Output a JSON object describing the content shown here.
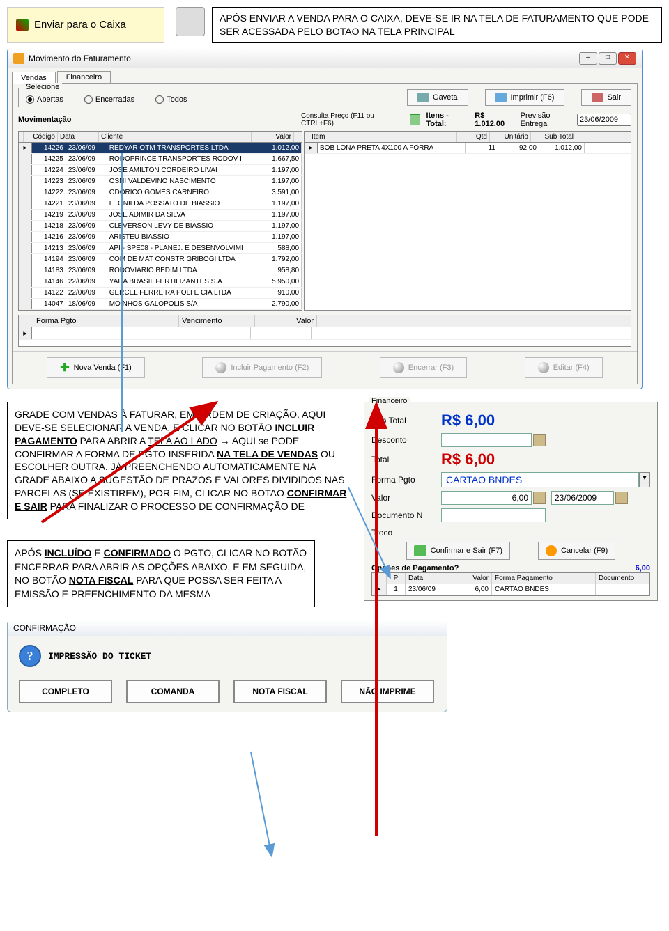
{
  "top": {
    "enviar_label": "Enviar para o Caixa",
    "callout": "APÓS ENVIAR A VENDA PARA O CAIXA, DEVE-SE IR NA TELA DE FATURAMENTO QUE PODE SER ACESSADA PELO BOTAO NA TELA PRINCIPAL"
  },
  "window": {
    "title": "Movimento do Faturamento",
    "tabs": [
      "Vendas",
      "Financeiro"
    ],
    "selecione_label": "Selecione",
    "radios": [
      "Abertas",
      "Encerradas",
      "Todos"
    ],
    "btn_gaveta": "Gaveta",
    "btn_imprimir": "Imprimir (F6)",
    "btn_sair": "Sair",
    "mov_label": "Movimentação",
    "consulta_label": "Consulta Preço (F11 ou CTRL+F6)",
    "itens_total_label": "Itens - Total:",
    "itens_total_value": "R$ 1.012,00",
    "prev_label": "Previsão Entrega",
    "prev_value": "23/06/2009",
    "grid_left_headers": [
      "Código",
      "Data",
      "Cliente",
      "Valor"
    ],
    "grid_left_rows": [
      {
        "cod": "14226",
        "data": "23/06/09",
        "cli": "REDYAR OTM TRANSPORTES LTDA",
        "val": "1.012,00",
        "sel": true
      },
      {
        "cod": "14225",
        "data": "23/06/09",
        "cli": "RODOPRINCE TRANSPORTES RODOV I",
        "val": "1.667,50"
      },
      {
        "cod": "14224",
        "data": "23/06/09",
        "cli": "JOSE AMILTON CORDEIRO LIVAI",
        "val": "1.197,00"
      },
      {
        "cod": "14223",
        "data": "23/06/09",
        "cli": "OSNI VALDEVINO NASCIMENTO",
        "val": "1.197,00"
      },
      {
        "cod": "14222",
        "data": "23/06/09",
        "cli": "ODORICO GOMES CARNEIRO",
        "val": "3.591,00"
      },
      {
        "cod": "14221",
        "data": "23/06/09",
        "cli": "LEONILDA POSSATO DE BIASSIO",
        "val": "1.197,00"
      },
      {
        "cod": "14219",
        "data": "23/06/09",
        "cli": "JOSE ADIMIR DA SILVA",
        "val": "1.197,00"
      },
      {
        "cod": "14218",
        "data": "23/06/09",
        "cli": "CLEVERSON LEVY DE BIASSIO",
        "val": "1.197,00"
      },
      {
        "cod": "14216",
        "data": "23/06/09",
        "cli": "ARISTEU BIASSIO",
        "val": "1.197,00"
      },
      {
        "cod": "14213",
        "data": "23/06/09",
        "cli": "API - SPE08 - PLANEJ. E DESENVOLVIMI",
        "val": "588,00"
      },
      {
        "cod": "14194",
        "data": "23/06/09",
        "cli": "COM DE MAT CONSTR GRIBOGI LTDA",
        "val": "1.792,00"
      },
      {
        "cod": "14183",
        "data": "23/06/09",
        "cli": "RODOVIARIO BEDIM LTDA",
        "val": "958,80"
      },
      {
        "cod": "14146",
        "data": "22/06/09",
        "cli": "YARA BRASIL FERTILIZANTES S.A",
        "val": "5.950,00"
      },
      {
        "cod": "14122",
        "data": "22/06/09",
        "cli": "GERCEL FERREIRA POLI E CIA LTDA",
        "val": "910,00"
      },
      {
        "cod": "14047",
        "data": "18/06/09",
        "cli": "MOINHOS GALOPOLIS S/A",
        "val": "2.790,00"
      }
    ],
    "grid_right_headers": [
      "Item",
      "Qtd",
      "Unitário",
      "Sub Total"
    ],
    "grid_right_rows": [
      {
        "item": "BOB LONA PRETA 4X100 A FORRA",
        "qtd": "11",
        "unit": "92,00",
        "sub": "1.012,00"
      }
    ],
    "forma_headers": [
      "Forma Pgto",
      "Vencimento",
      "Valor"
    ],
    "btn_nova": "Nova Venda (F1)",
    "btn_incluir": "Incluir Pagamento (F2)",
    "btn_encerrar": "Encerrar (F3)",
    "btn_editar": "Editar (F4)"
  },
  "mid_callout": "GRADE COM VENDAS À FATURAR, EM ORDEM DE CRIAÇÃO. AQUI DEVE-SE SELECIONAR A VENDA, E CLICAR NO BOTÃO <b><u>INCLUIR PAGAMENTO</u></b> PARA ABRIR A <u>TELA AO LADO</u> → AQUI se PODE CONFIRMAR A FORMA DE PGTO INSERIDA <b><u>NA TELA DE VENDAS</u></b> OU ESCOLHER OUTRA. JÁ PREENCHENDO AUTOMATICAMENTE NA GRADE ABAIXO A SUGESTÃO DE PRAZOS E VALORES DIVIDIDOS NAS PARCELAS (SE EXISTIREM), POR FIM, CLICAR NO BOTAO <b><u>CONFIRMAR E SAIR</u></b> PARA FINALIZAR O PROCESSO DE CONFIRMAÇÃO DE",
  "fin": {
    "title": "Financeiro",
    "sub_label": "Sub Total",
    "sub_value": "R$ 6,00",
    "desc_label": "Desconto",
    "total_label": "Total",
    "total_value": "R$ 6,00",
    "forma_label": "Forma Pgto",
    "forma_value": "CARTAO BNDES",
    "valor_label": "Valor",
    "valor_value": "6,00",
    "valor_date": "23/06/2009",
    "doc_label": "Documento N",
    "troco_label": "Troco",
    "btn_confirmar": "Confirmar e Sair (F7)",
    "btn_cancelar": "Cancelar (F9)",
    "opg_label": "Opções de Pagamento?",
    "opg_amount": "6,00",
    "opg_headers": [
      "P",
      "Data",
      "Valor",
      "Forma Pagamento",
      "Documento"
    ],
    "opg_rows": [
      {
        "p": "1",
        "data": "23/06/09",
        "valor": "6,00",
        "forma": "CARTAO BNDES",
        "doc": ""
      }
    ]
  },
  "callout2": "APÓS <b><u>INCLUÍDO</u></b> E <b><u>CONFIRMADO</u></b> O PGTO, CLICAR NO BOTÃO ENCERRAR PARA ABRIR AS OPÇÕES ABAIXO, E EM SEGUIDA, NO BOTÃO <b><u>NOTA FISCAL</u></b> PARA QUE POSSA SER FEITA A EMISSÃO E PREENCHIMENTO DA MESMA",
  "confirm": {
    "title": "CONFIRMAÇÃO",
    "msg": "IMPRESSÃO DO TICKET",
    "btns": [
      "COMPLETO",
      "COMANDA",
      "NOTA FISCAL",
      "NÃO IMPRIME"
    ]
  }
}
